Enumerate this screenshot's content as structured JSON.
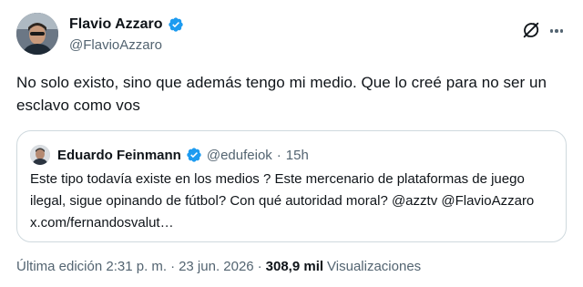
{
  "author": {
    "display_name": "Flavio Azzaro",
    "handle": "@FlavioAzzaro",
    "verified_color": "#1d9bf0"
  },
  "icons": {
    "verified": "verified-badge-icon",
    "grok": "grok-icon",
    "more": "more-options-icon"
  },
  "tweet": {
    "text": "No solo existo, sino que además tengo mi medio. Que lo creé para no ser un esclavo como vos"
  },
  "quote": {
    "display_name": "Eduardo Feinmann",
    "handle": "@edufeiok",
    "dot": "·",
    "time": "15h",
    "text": "Este tipo todavía existe en los medios ?  Este mercenario de plataformas de juego ilegal, sigue opinando de fútbol?  Con qué autoridad moral? @azztv @FlavioAzzaro x.com/fernandosvalut…"
  },
  "meta": {
    "edited": "Última edición 2:31 p. m.",
    "sep1": "·",
    "date": "23 jun. 2026",
    "sep2": "·",
    "views_count": "308,9 mil",
    "views_label": "Visualizaciones"
  }
}
